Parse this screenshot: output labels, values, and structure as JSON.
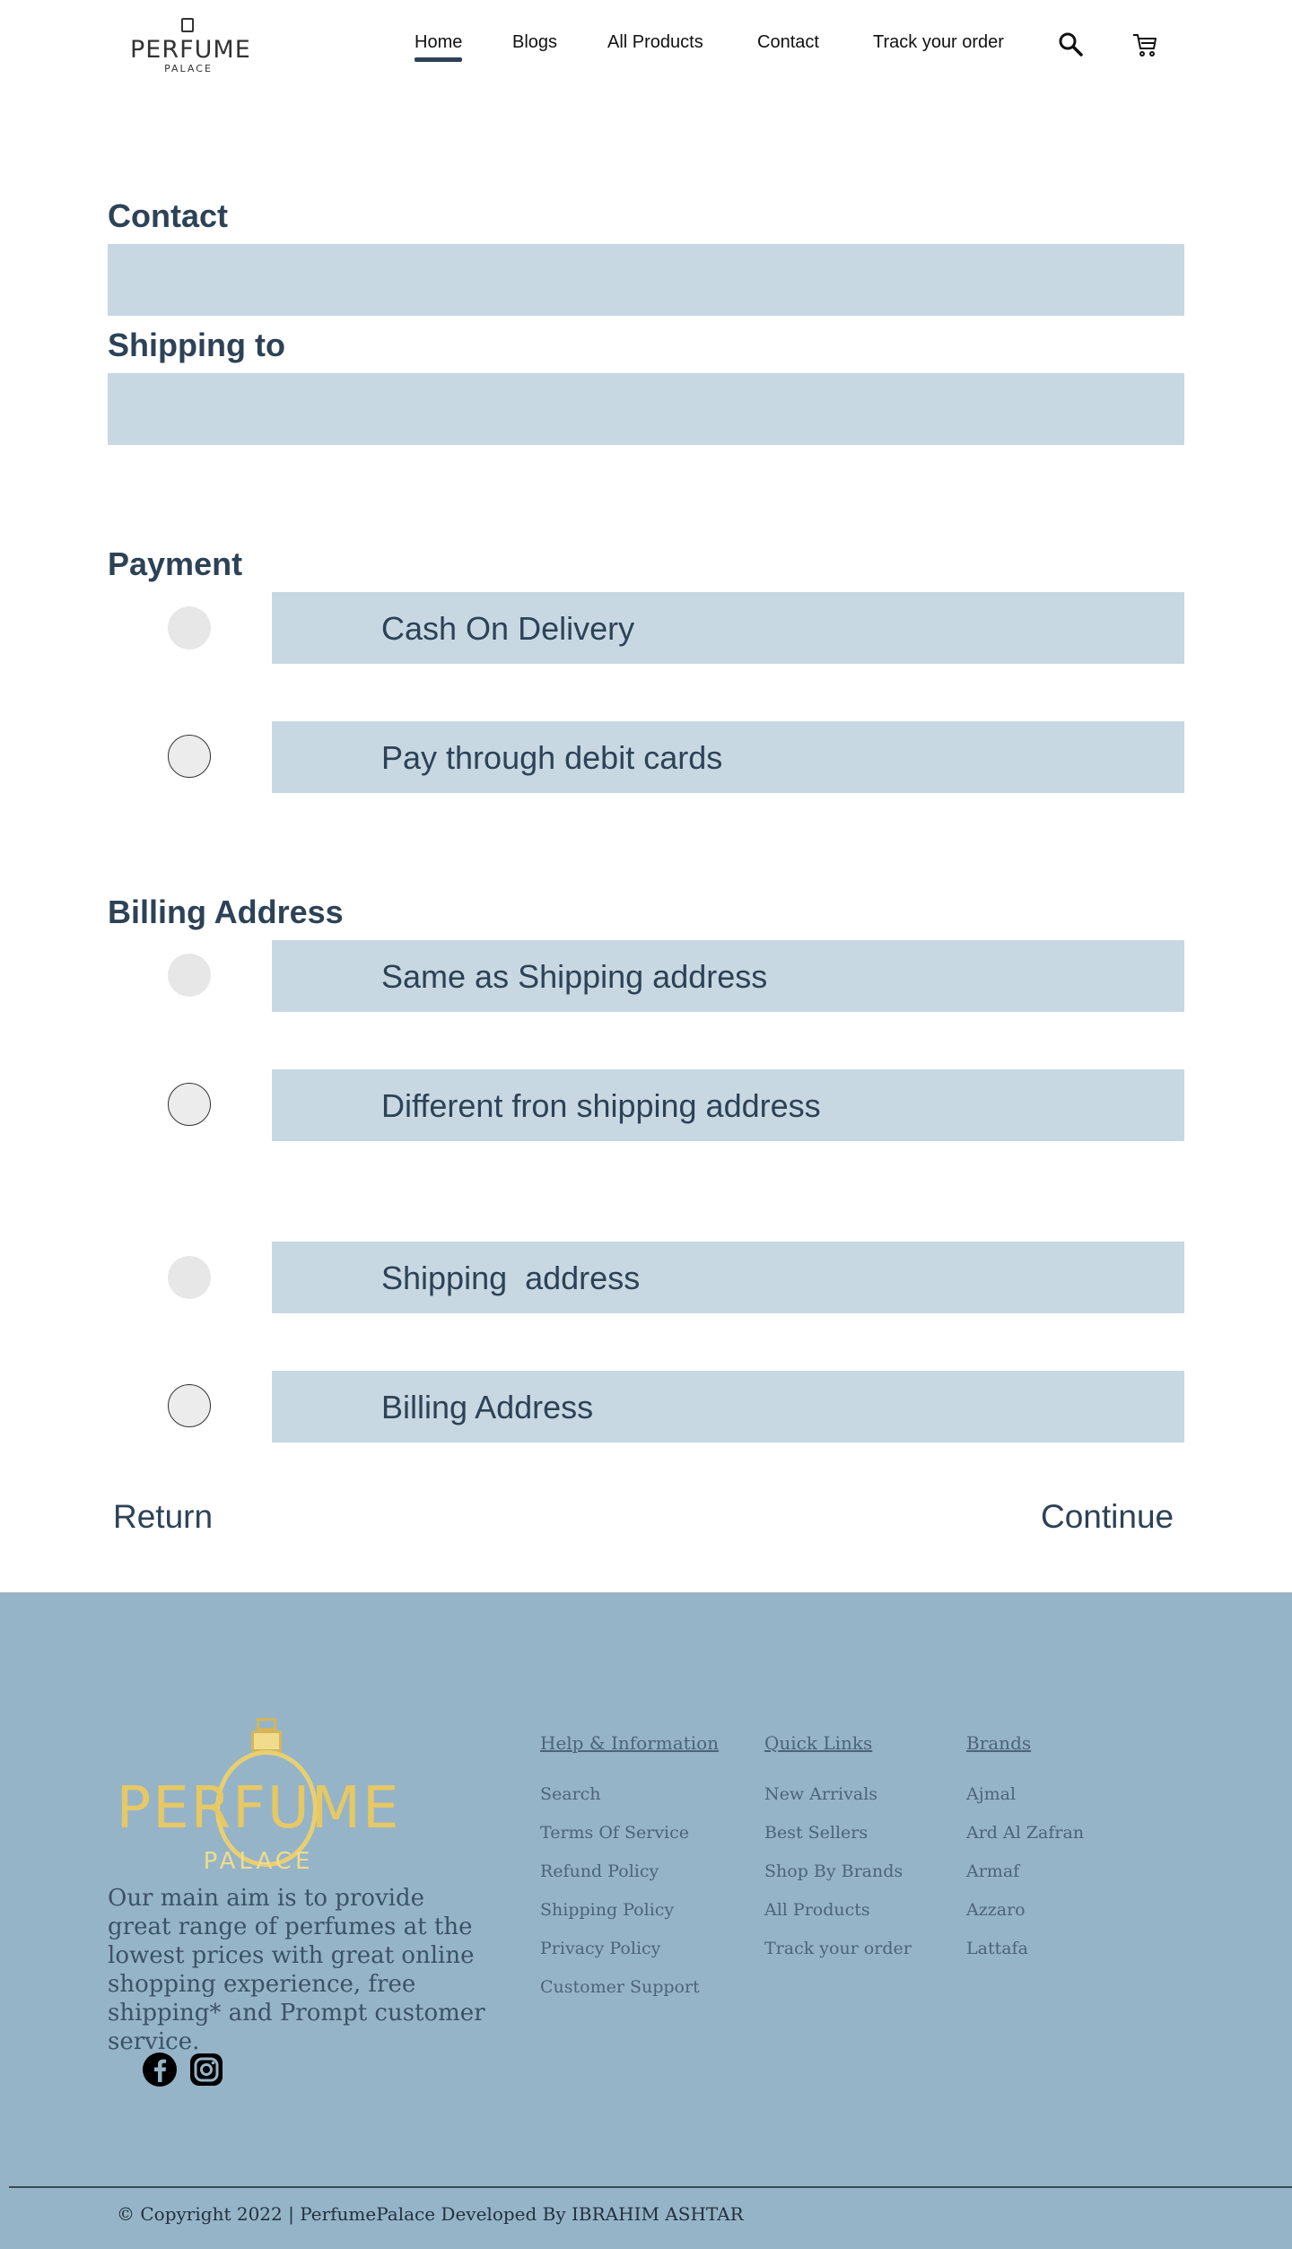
{
  "header": {
    "logo_text": "PERFUME",
    "logo_sub": "PALACE",
    "nav": {
      "home": "Home",
      "blogs": "Blogs",
      "all_products": "All Products",
      "contact": "Contact",
      "track_order": "Track your order"
    },
    "icons": {
      "search": "search-icon",
      "cart": "cart-icon"
    }
  },
  "checkout": {
    "contact_title": "Contact",
    "shipping_title": "Shipping to",
    "payment_title": "Payment",
    "payment_options": [
      "Cash On Delivery",
      "Pay through debit cards"
    ],
    "billing_title": "Billing Address",
    "billing_options": [
      "Same as Shipping address",
      "Different fron shipping address"
    ],
    "address_options": [
      "Shipping  address",
      "Billing Address"
    ],
    "return_label": "Return",
    "continue_label": "Continue"
  },
  "footer": {
    "logo_text": "PERFUME",
    "logo_sub": "PALACE",
    "about": "Our main aim is to provide great range of perfumes at the lowest prices with great online shopping experience, free shipping* and Prompt customer service.",
    "help": {
      "title": "Help & Information",
      "links": [
        "Search",
        "Terms Of Service",
        "Refund Policy",
        "Shipping Policy",
        "Privacy Policy",
        "Customer Support"
      ]
    },
    "quick": {
      "title": "Quick Links",
      "links": [
        "New Arrivals",
        "Best Sellers",
        "Shop By Brands",
        "All Products",
        "Track your order"
      ]
    },
    "brands": {
      "title": "Brands",
      "links": [
        "Ajmal",
        "Ard Al Zafran",
        "Armaf",
        "Azzaro",
        "Lattafa"
      ]
    },
    "social": [
      "facebook-icon",
      "instagram-icon"
    ],
    "copyright": "© Copyright 2022 | PerfumePalace Developed By IBRAHIM ASHTAR"
  },
  "colors": {
    "accent": "#2d4256",
    "field_bg": "#c8d8e2",
    "footer_bg": "#96b4c8",
    "gold": "#e6c865"
  }
}
